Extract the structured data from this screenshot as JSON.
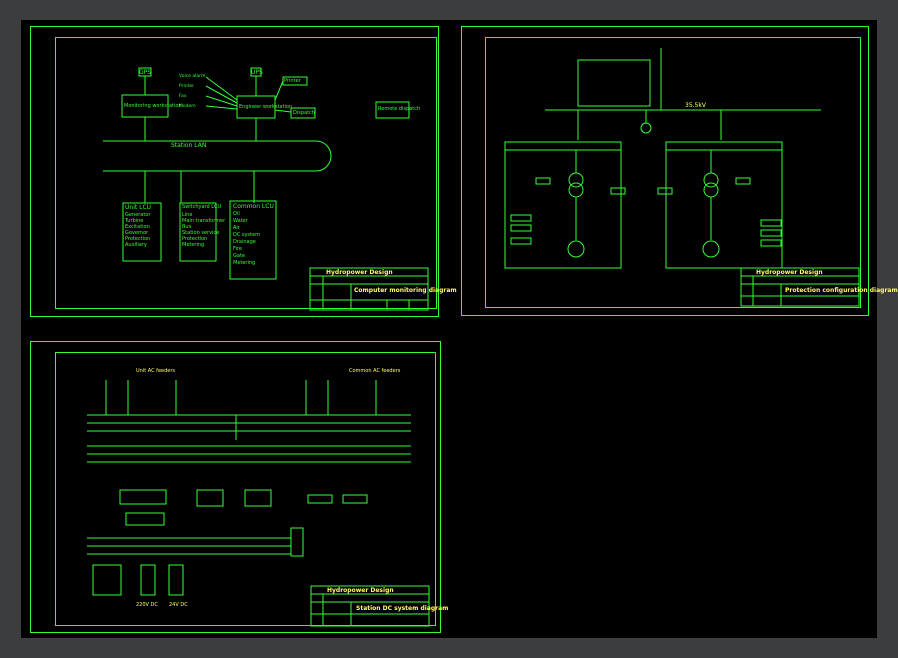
{
  "colors": {
    "line": "#33ff33",
    "label": "#ffff66",
    "background": "#000000",
    "frame": "#3b3d3f"
  },
  "sheet1": {
    "top_left_box": "GPS",
    "top_mid_box": "UPS",
    "left_station": "Monitoring workstation",
    "mid_station": "Engineer workstation",
    "bus": "Station LAN",
    "left_inputs": [
      "Voice alarm",
      "Printer",
      "Fax",
      "Modem"
    ],
    "right_box1": "Printer",
    "right_box2": "Dispatch",
    "far_right": "Remote dispatch",
    "lcu1_title": "Unit LCU",
    "lcu1_items": [
      "Generator",
      "Turbine",
      "Excitation",
      "Governor",
      "Protection",
      "Auxiliary"
    ],
    "lcu2_title": "Switchyard LCU",
    "lcu2_items": [
      "Line",
      "Main transformer",
      "Bus",
      "Station service",
      "Protection",
      "Metering"
    ],
    "lcu3_title": "Common LCU",
    "lcu3_items": [
      "Oil",
      "Water",
      "Air",
      "DC system",
      "Drainage",
      "Fire",
      "Gate",
      "Metering"
    ],
    "title_block": {
      "company": "Hydropower Design",
      "drawing": "Computer monitoring diagram"
    }
  },
  "sheet2": {
    "bus_label": "35.5kV",
    "title_block": {
      "company": "Hydropower Design",
      "drawing": "Protection configuration diagram"
    }
  },
  "sheet3": {
    "top_left_caption": "Unit AC feeders",
    "top_right_caption": "Common AC feeders",
    "bottom_left_caption": "220V DC",
    "bottom_right_caption": "24V DC",
    "title_block": {
      "company": "Hydropower Design",
      "drawing": "Station DC system diagram"
    }
  }
}
